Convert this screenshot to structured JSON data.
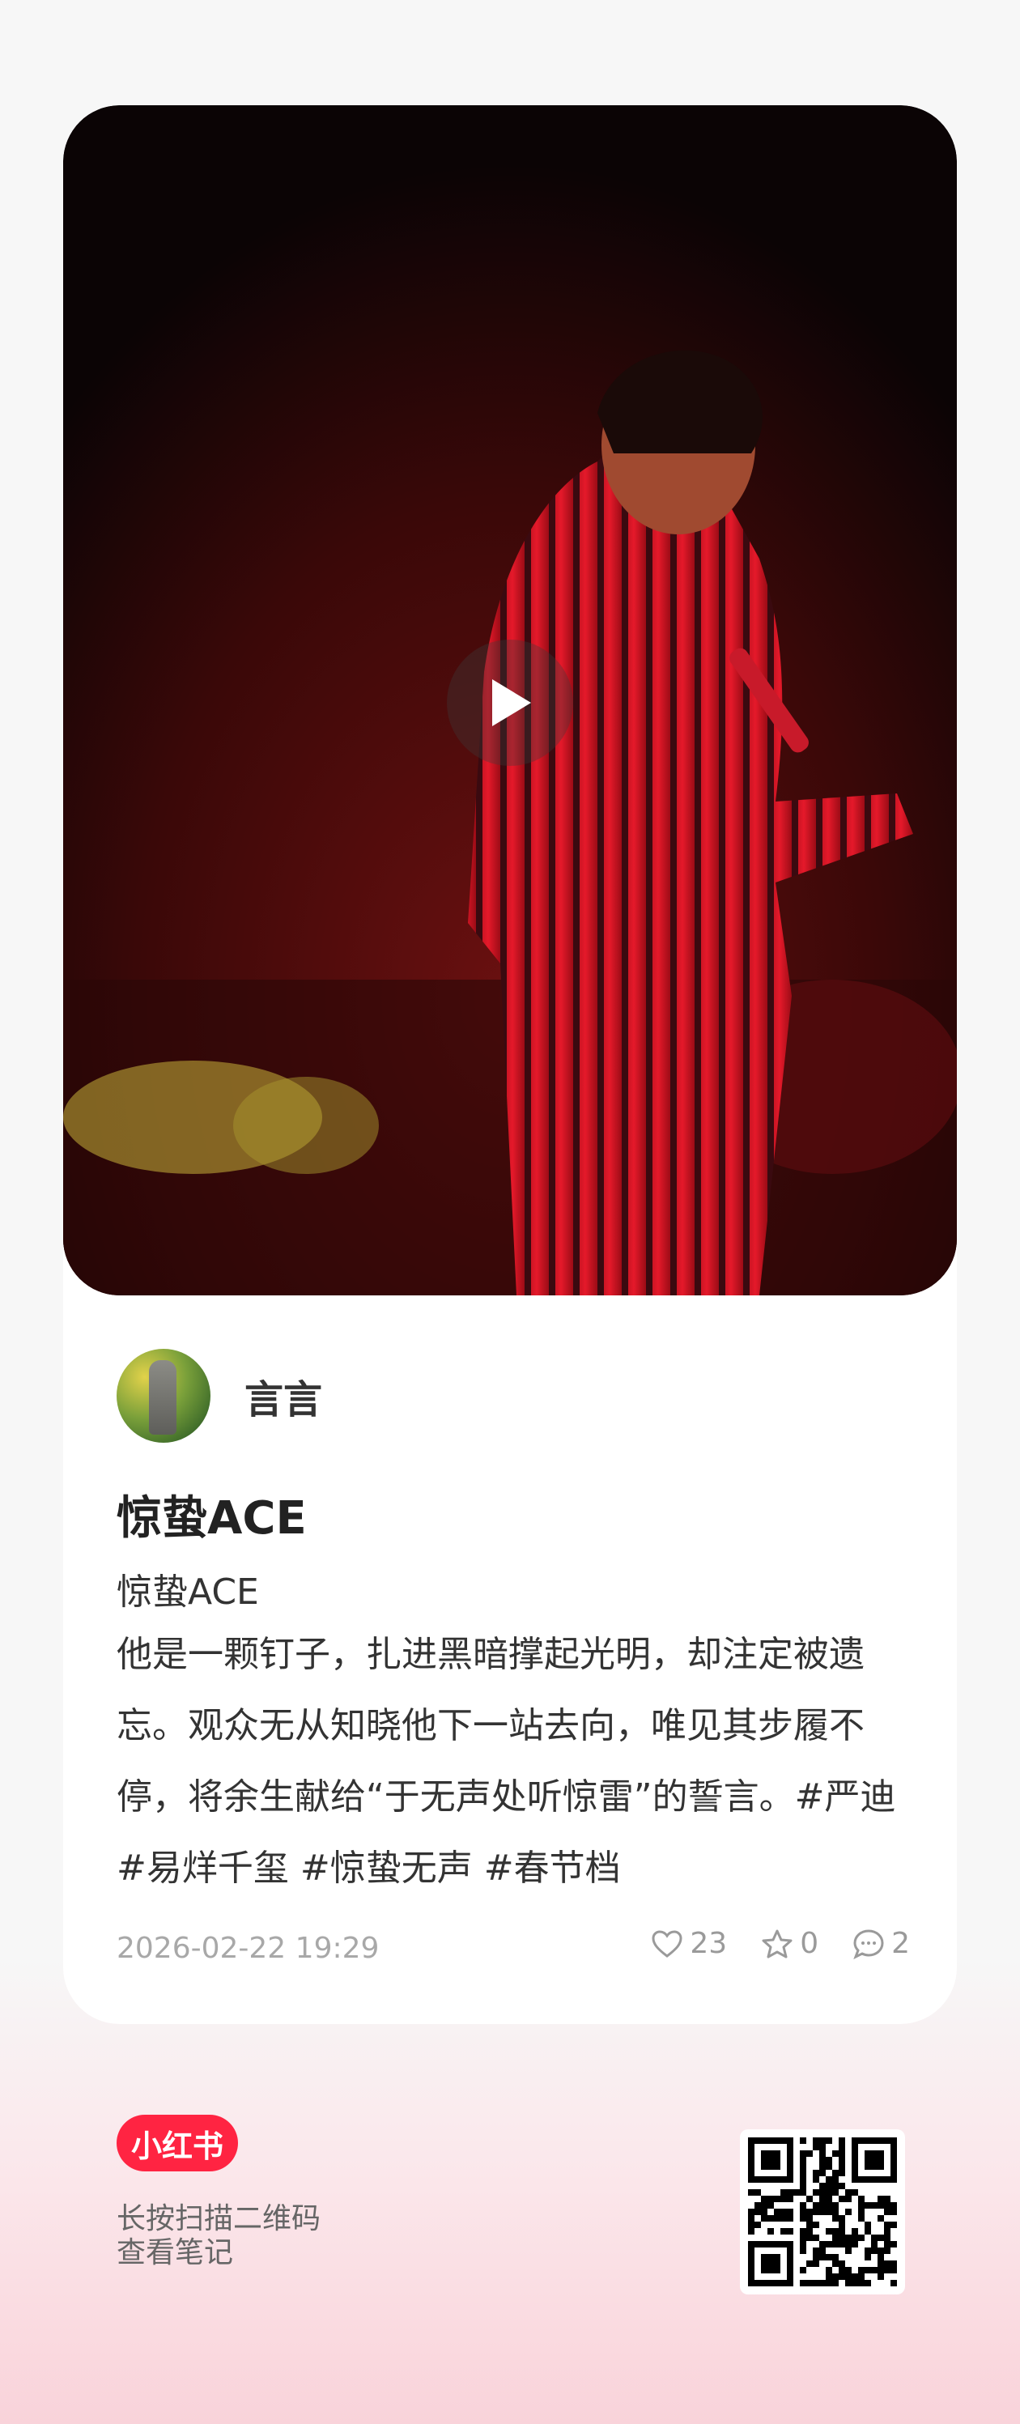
{
  "note": {
    "author": "言言",
    "title": "惊蛰ACE",
    "subtitle": "惊蛰ACE",
    "body": "他是一颗钉子，扎进黑暗撑起光明，却注定被遗忘。观众无从知晓他下一站去向，唯见其步履不停，将余生献给“于无声处听惊雷”的誓言。#严迪 #易烊千玺 #惊蛰无声 #春节档",
    "date": "2026-02-22 19:29",
    "likes": "23",
    "collects": "0",
    "comments": "2"
  },
  "footer": {
    "brand": "小红书",
    "hint_line1": "长按扫描二维码",
    "hint_line2": "查看笔记"
  },
  "icons": {
    "play": "play-icon",
    "like": "heart-icon",
    "collect": "star-icon",
    "comment": "comment-icon"
  },
  "colors": {
    "brand": "#ff2442",
    "text": "#333333",
    "meta": "#9a9a9a"
  }
}
